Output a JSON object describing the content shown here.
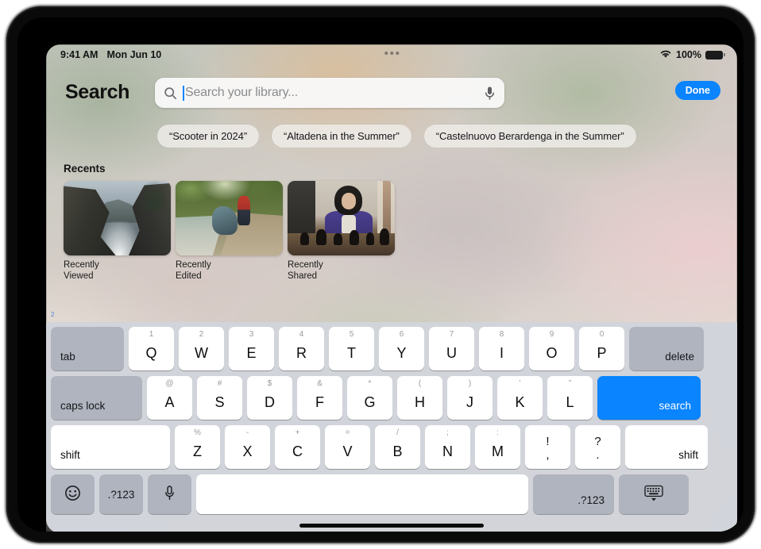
{
  "status_bar": {
    "time": "9:41 AM",
    "date": "Mon Jun 10",
    "wifi_icon": "wifi-icon",
    "battery_percent": "100%",
    "battery_icon": "battery-full-icon",
    "menu_dots_icon": "multitasking-dots-icon"
  },
  "header": {
    "title": "Search",
    "done_label": "Done",
    "search": {
      "placeholder": "Search your library...",
      "value": "",
      "search_icon": "magnifying-glass-icon",
      "mic_icon": "microphone-icon"
    }
  },
  "suggestions": [
    {
      "label": "“Scooter in 2024”"
    },
    {
      "label": "“Altadena in the Summer”"
    },
    {
      "label": "“Castelnuovo Berardenga in the Summer”"
    }
  ],
  "recents": {
    "title": "Recents",
    "items": [
      {
        "label": "Recently Viewed",
        "art": "coast"
      },
      {
        "label": "Recently Edited",
        "art": "creek"
      },
      {
        "label": "Recently Shared",
        "art": "chess"
      }
    ]
  },
  "keyboard": {
    "row1": {
      "tab": "tab",
      "keys": [
        {
          "alt": "1",
          "main": "Q"
        },
        {
          "alt": "2",
          "main": "W"
        },
        {
          "alt": "3",
          "main": "E"
        },
        {
          "alt": "4",
          "main": "R"
        },
        {
          "alt": "5",
          "main": "T"
        },
        {
          "alt": "6",
          "main": "Y"
        },
        {
          "alt": "7",
          "main": "U"
        },
        {
          "alt": "8",
          "main": "I"
        },
        {
          "alt": "9",
          "main": "O"
        },
        {
          "alt": "0",
          "main": "P"
        }
      ],
      "delete": "delete"
    },
    "row2": {
      "caps_lock": "caps lock",
      "keys": [
        {
          "alt": "@",
          "main": "A"
        },
        {
          "alt": "#",
          "main": "S"
        },
        {
          "alt": "$",
          "main": "D"
        },
        {
          "alt": "&",
          "main": "F"
        },
        {
          "alt": "*",
          "main": "G"
        },
        {
          "alt": "(",
          "main": "H"
        },
        {
          "alt": ")",
          "main": "J"
        },
        {
          "alt": "’",
          "main": "K"
        },
        {
          "alt": "”",
          "main": "L"
        }
      ],
      "search": "search"
    },
    "row3": {
      "shift_left": "shift",
      "keys": [
        {
          "alt": "%",
          "main": "Z"
        },
        {
          "alt": "-",
          "main": "X"
        },
        {
          "alt": "+",
          "main": "C"
        },
        {
          "alt": "=",
          "main": "V"
        },
        {
          "alt": "/",
          "main": "B"
        },
        {
          "alt": ";",
          "main": "N"
        },
        {
          "alt": ":",
          "main": "M"
        }
      ],
      "punct": [
        {
          "top": "!",
          "bottom": ","
        },
        {
          "top": "?",
          "bottom": "."
        }
      ],
      "shift_right": "shift"
    },
    "row4": {
      "emoji_icon": "emoji-smiley-icon",
      "numbers_left": ".?123",
      "mic_icon": "microphone-icon",
      "space": "",
      "numbers_right": ".?123",
      "dismiss_icon": "dismiss-keyboard-icon"
    }
  },
  "colors": {
    "accent_blue": "#0a84ff",
    "key_white": "#ffffff",
    "key_modifier": "#acb2bc",
    "keyboard_bg": "#d1d4da"
  }
}
